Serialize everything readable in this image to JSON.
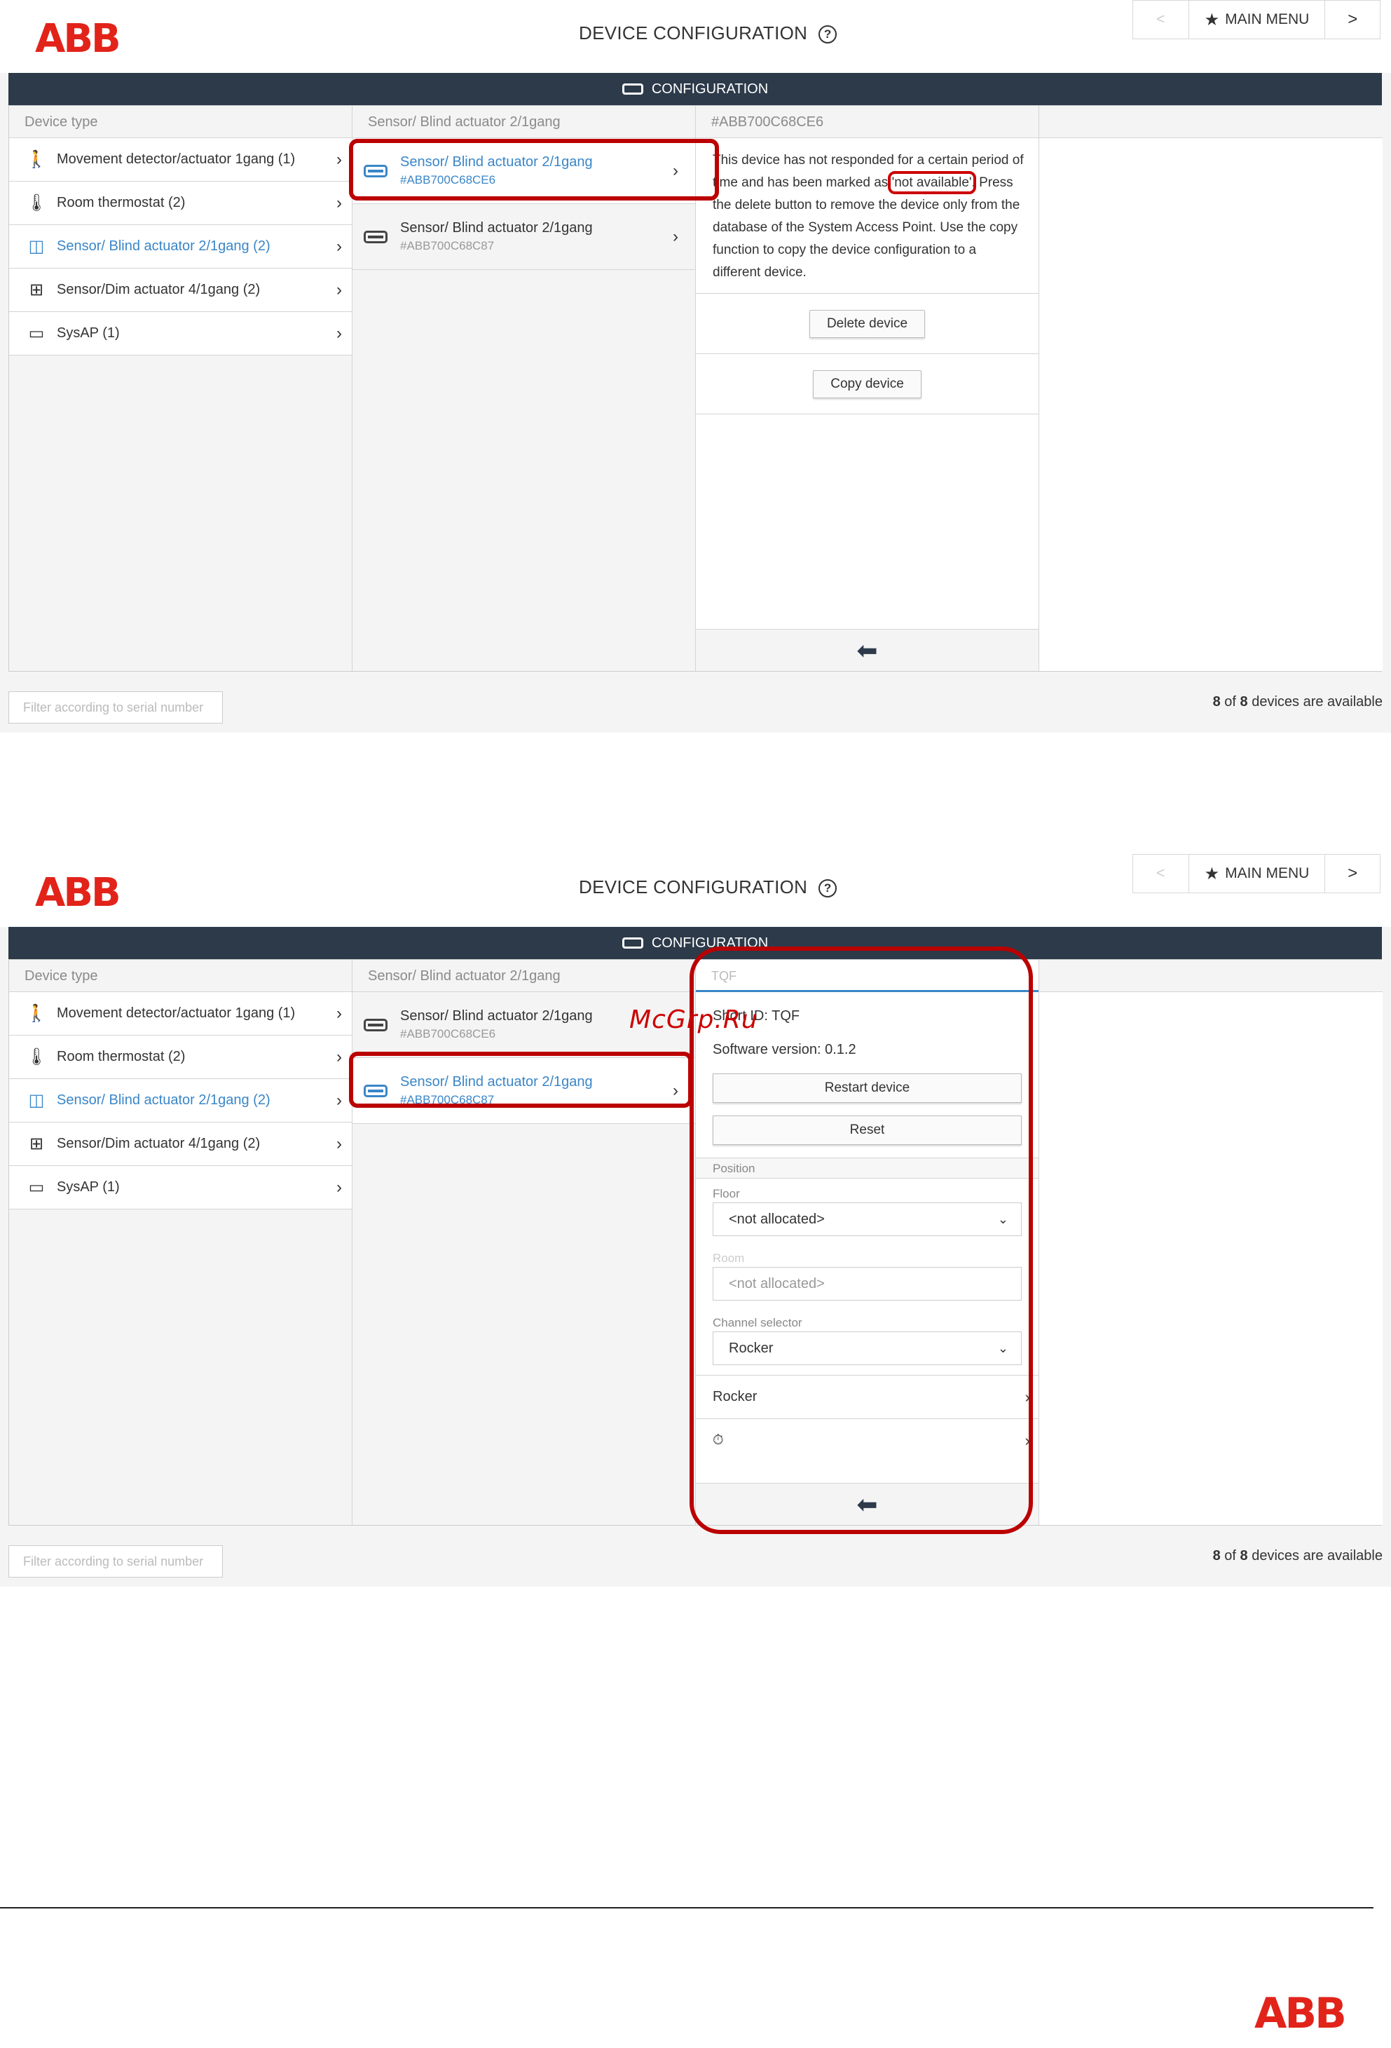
{
  "brand": {
    "logo": "ABB",
    "accent_color": "#e2231a",
    "bar_color": "#2c3a4a",
    "selected_color": "#3a86c8",
    "highlight_color": "#b00000"
  },
  "header": {
    "title": "DEVICE CONFIGURATION",
    "help_icon": "?",
    "prev_label": "<",
    "main_menu": "MAIN MENU",
    "next_label": ">"
  },
  "bar": {
    "label": "CONFIGURATION"
  },
  "columns": {
    "device_type": "Device type",
    "group": "Sensor/ Blind actuator 2/1gang"
  },
  "device_types": [
    {
      "label": "Movement detector/actuator 1gang (1)",
      "icon": "motion-person-icon"
    },
    {
      "label": "Room thermostat (2)",
      "icon": "thermometer-icon"
    },
    {
      "label": "Sensor/ Blind actuator 2/1gang (2)",
      "icon": "blind-actuator-icon"
    },
    {
      "label": "Sensor/Dim actuator 4/1gang (2)",
      "icon": "dim-actuator-icon"
    },
    {
      "label": "SysAP (1)",
      "icon": "sysap-icon"
    }
  ],
  "devices": [
    {
      "name": "Sensor/ Blind actuator 2/1gang",
      "serial": "#ABB700C68CE6"
    },
    {
      "name": "Sensor/ Blind actuator 2/1gang",
      "serial": "#ABB700C68C87"
    }
  ],
  "screen1": {
    "detail_header": "#ABB700C68CE6",
    "desc_a": "This device has not responded for a certain period of time and has been marked as ",
    "desc_hl": "'not available'",
    "desc_b": ". Press the delete button to remove the device only from the database of the System Access Point. Use the copy function to copy the device configuration to a different device.",
    "delete_button": "Delete device",
    "copy_button": "Copy device"
  },
  "screen2": {
    "name_field": "TQF",
    "short_id_label": "Short ID:",
    "short_id": "TQF",
    "sw_label": "Software version:",
    "sw_version": "0.1.2",
    "restart_button": "Restart device",
    "reset_button": "Reset",
    "position_section": "Position",
    "floor_label": "Floor",
    "floor_value": "<not allocated>",
    "room_label": "Room",
    "room_value": "<not allocated>",
    "channel_label": "Channel selector",
    "channel_value": "Rocker",
    "row_rocker": "Rocker",
    "row_clock": "⏱"
  },
  "footer": {
    "filter_placeholder": "Filter according to serial number",
    "count_a": "8",
    "count_of": " of ",
    "count_b": "8",
    "count_rest": " devices are available"
  },
  "watermark": "McGrp.Ru"
}
